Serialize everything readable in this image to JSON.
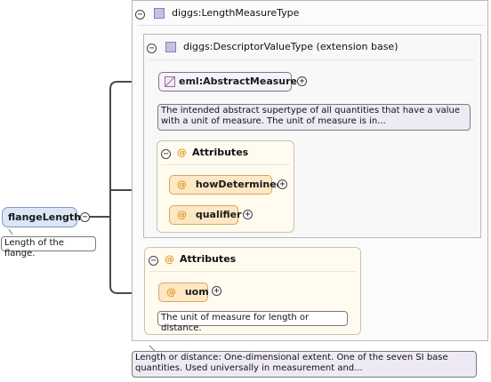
{
  "root": {
    "name": "flangeLength",
    "doc": "Length of the flange."
  },
  "type_panel": {
    "title": "diggs:LengthMeasureType",
    "doc": "Length or distance: One-dimensional extent. One of the seven SI base quantities. Used universally in measurement and..."
  },
  "base_panel": {
    "title": "diggs:DescriptorValueType (extension base)"
  },
  "abstract_measure": {
    "name": "eml:AbstractMeasure",
    "doc": "The intended abstract supertype of all quantities that have a value with a unit of measure. The unit of measure is in..."
  },
  "inner_attributes": {
    "title": "Attributes",
    "items": [
      {
        "name": "howDetermined"
      },
      {
        "name": "qualifier"
      }
    ]
  },
  "outer_attributes": {
    "title": "Attributes",
    "items": [
      {
        "name": "uom",
        "doc": "The unit of measure for length or distance."
      }
    ]
  },
  "symbols": {
    "at": "@",
    "collapse": "−",
    "expand": "+"
  },
  "colors": {
    "attr_fill": "#fde7c4",
    "root_fill": "#dbe6f7",
    "doc_fill": "#eeeaf5",
    "type_icon": "#c9bfe3"
  }
}
